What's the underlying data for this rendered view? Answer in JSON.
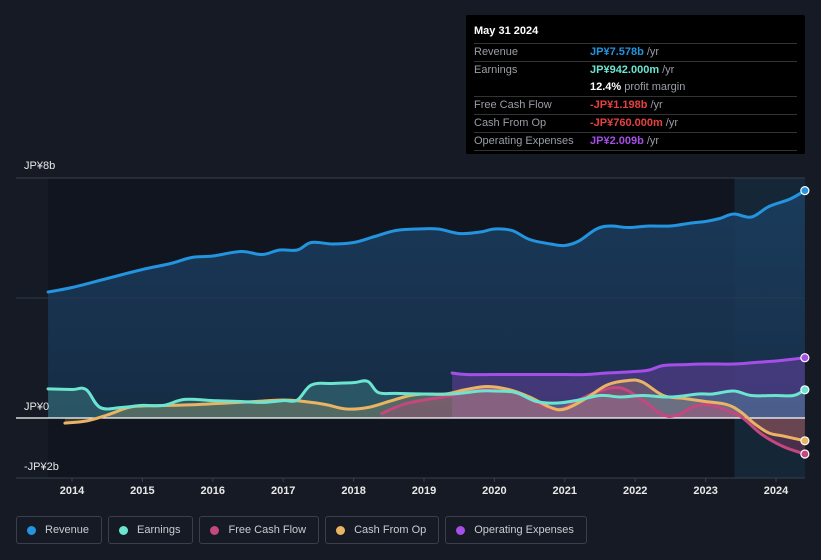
{
  "tooltip": {
    "date": "May 31 2024",
    "rows": [
      {
        "label": "Revenue",
        "value": "JP¥7.578b",
        "unit": "/yr",
        "color": "#2394df"
      },
      {
        "label": "Earnings",
        "value": "JP¥942.000m",
        "unit": "/yr",
        "color": "#6ce5d0"
      },
      {
        "label": "",
        "value": "12.4%",
        "unit": "profit margin",
        "color": "#ffffff"
      },
      {
        "label": "Free Cash Flow",
        "value": "-JP¥1.198b",
        "unit": "/yr",
        "color": "#e64141"
      },
      {
        "label": "Cash From Op",
        "value": "-JP¥760.000m",
        "unit": "/yr",
        "color": "#e64141"
      },
      {
        "label": "Operating Expenses",
        "value": "JP¥2.009b",
        "unit": "/yr",
        "color": "#a54ee8"
      }
    ]
  },
  "legend": [
    {
      "label": "Revenue",
      "color": "#2394df"
    },
    {
      "label": "Earnings",
      "color": "#6ce5d0"
    },
    {
      "label": "Free Cash Flow",
      "color": "#c4477f"
    },
    {
      "label": "Cash From Op",
      "color": "#e9b463"
    },
    {
      "label": "Operating Expenses",
      "color": "#a54ee8"
    }
  ],
  "chart_data": {
    "type": "area",
    "title": "",
    "xlabel": "",
    "ylabel": "",
    "y_tick_labels": [
      "JP¥8b",
      "JP¥0",
      "-JP¥2b"
    ],
    "y_ticks": [
      8,
      0,
      -2
    ],
    "ylim": [
      -2,
      8
    ],
    "xlim": [
      2013.66,
      2024.41
    ],
    "x_tick_labels": [
      "2014",
      "2015",
      "2016",
      "2017",
      "2018",
      "2019",
      "2020",
      "2021",
      "2022",
      "2023",
      "2024"
    ],
    "x_ticks": [
      2014,
      2015,
      2016,
      2017,
      2018,
      2019,
      2020,
      2021,
      2022,
      2023,
      2024
    ],
    "highlight_from": 2023.41,
    "units": "JP¥ billions",
    "legend_position": "bottom",
    "series": [
      {
        "name": "Revenue",
        "color": "#2394df",
        "x": [
          2013.66,
          2014.0,
          2014.5,
          2015.0,
          2015.4,
          2015.7,
          2016.0,
          2016.4,
          2016.7,
          2016.95,
          2017.2,
          2017.4,
          2017.7,
          2018.0,
          2018.3,
          2018.6,
          2018.9,
          2019.2,
          2019.5,
          2019.8,
          2020.0,
          2020.25,
          2020.5,
          2020.8,
          2021.0,
          2021.2,
          2021.45,
          2021.65,
          2021.9,
          2022.2,
          2022.5,
          2022.8,
          2023.0,
          2023.2,
          2023.4,
          2023.65,
          2023.9,
          2024.2,
          2024.41
        ],
        "values": [
          4.2,
          4.35,
          4.65,
          4.95,
          5.15,
          5.35,
          5.4,
          5.55,
          5.45,
          5.6,
          5.6,
          5.85,
          5.8,
          5.85,
          6.05,
          6.25,
          6.3,
          6.3,
          6.15,
          6.2,
          6.3,
          6.25,
          5.95,
          5.8,
          5.75,
          5.9,
          6.3,
          6.4,
          6.35,
          6.4,
          6.4,
          6.5,
          6.55,
          6.65,
          6.8,
          6.7,
          7.05,
          7.3,
          7.58
        ]
      },
      {
        "name": "Earnings",
        "color": "#6ce5d0",
        "x": [
          2013.66,
          2014.0,
          2014.2,
          2014.4,
          2014.7,
          2015.0,
          2015.3,
          2015.6,
          2016.0,
          2016.4,
          2016.7,
          2017.0,
          2017.2,
          2017.4,
          2017.7,
          2018.0,
          2018.2,
          2018.35,
          2018.6,
          2019.0,
          2019.4,
          2019.8,
          2020.0,
          2020.3,
          2020.6,
          2020.9,
          2021.2,
          2021.5,
          2021.8,
          2022.1,
          2022.5,
          2022.9,
          2023.1,
          2023.4,
          2023.65,
          2024.0,
          2024.25,
          2024.41
        ],
        "values": [
          0.97,
          0.95,
          0.95,
          0.35,
          0.35,
          0.42,
          0.42,
          0.62,
          0.58,
          0.55,
          0.52,
          0.58,
          0.6,
          1.1,
          1.15,
          1.18,
          1.22,
          0.85,
          0.82,
          0.8,
          0.8,
          0.9,
          0.9,
          0.85,
          0.55,
          0.5,
          0.6,
          0.75,
          0.7,
          0.75,
          0.7,
          0.8,
          0.8,
          0.9,
          0.75,
          0.75,
          0.75,
          0.94
        ]
      },
      {
        "name": "Free Cash Flow",
        "color": "#c4477f",
        "x": [
          2018.4,
          2018.7,
          2019.0,
          2019.4,
          2019.8,
          2020.1,
          2020.4,
          2020.7,
          2020.95,
          2021.2,
          2021.5,
          2021.8,
          2022.1,
          2022.4,
          2022.6,
          2022.8,
          2023.0,
          2023.25,
          2023.5,
          2023.8,
          2024.1,
          2024.41
        ],
        "values": [
          0.15,
          0.45,
          0.6,
          0.75,
          0.95,
          0.95,
          0.75,
          0.4,
          0.3,
          0.6,
          0.9,
          1.0,
          0.6,
          0.1,
          0.1,
          0.35,
          0.45,
          0.3,
          0.05,
          -0.55,
          -0.95,
          -1.2
        ]
      },
      {
        "name": "Cash From Op",
        "color": "#e9b463",
        "x": [
          2013.9,
          2014.2,
          2014.5,
          2014.8,
          2015.0,
          2015.4,
          2015.8,
          2016.2,
          2016.6,
          2017.0,
          2017.3,
          2017.6,
          2017.9,
          2018.2,
          2018.5,
          2018.8,
          2019.0,
          2019.3,
          2019.6,
          2019.9,
          2020.2,
          2020.5,
          2020.8,
          2021.0,
          2021.3,
          2021.6,
          2021.9,
          2022.1,
          2022.4,
          2022.7,
          2023.0,
          2023.3,
          2023.5,
          2023.7,
          2023.9,
          2024.1,
          2024.41
        ],
        "values": [
          -0.17,
          -0.1,
          0.1,
          0.35,
          0.4,
          0.42,
          0.45,
          0.5,
          0.55,
          0.6,
          0.55,
          0.45,
          0.3,
          0.35,
          0.55,
          0.75,
          0.8,
          0.8,
          0.95,
          1.05,
          0.95,
          0.7,
          0.35,
          0.3,
          0.65,
          1.1,
          1.25,
          1.2,
          0.75,
          0.65,
          0.55,
          0.45,
          0.2,
          -0.2,
          -0.5,
          -0.6,
          -0.76
        ]
      },
      {
        "name": "Operating Expenses",
        "color": "#a54ee8",
        "x": [
          2019.4,
          2019.6,
          2020.0,
          2020.5,
          2021.0,
          2021.3,
          2021.6,
          2022.0,
          2022.2,
          2022.4,
          2022.7,
          2023.0,
          2023.4,
          2023.7,
          2024.0,
          2024.2,
          2024.41
        ],
        "values": [
          1.5,
          1.45,
          1.45,
          1.45,
          1.45,
          1.45,
          1.5,
          1.55,
          1.6,
          1.75,
          1.78,
          1.8,
          1.8,
          1.85,
          1.9,
          1.95,
          2.01
        ]
      }
    ]
  }
}
